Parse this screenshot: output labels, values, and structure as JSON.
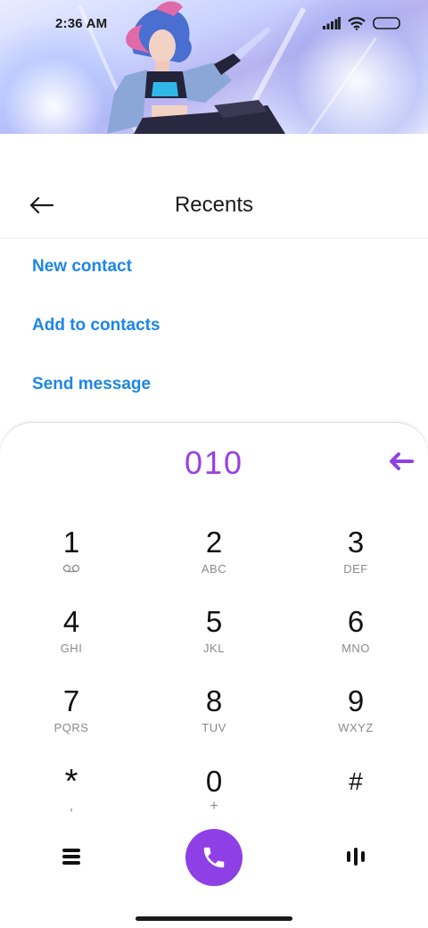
{
  "status_bar": {
    "time": "2:36 AM"
  },
  "header": {
    "title": "Recents"
  },
  "actions": {
    "new_contact": "New contact",
    "add_to_contacts": "Add to contacts",
    "send_message": "Send message"
  },
  "dialer": {
    "number": "010",
    "keys": [
      {
        "digit": "1",
        "letters": ""
      },
      {
        "digit": "2",
        "letters": "ABC"
      },
      {
        "digit": "3",
        "letters": "DEF"
      },
      {
        "digit": "4",
        "letters": "GHI"
      },
      {
        "digit": "5",
        "letters": "JKL"
      },
      {
        "digit": "6",
        "letters": "MNO"
      },
      {
        "digit": "7",
        "letters": "PQRS"
      },
      {
        "digit": "8",
        "letters": "TUV"
      },
      {
        "digit": "9",
        "letters": "WXYZ"
      },
      {
        "digit": "*",
        "letters": ","
      },
      {
        "digit": "0",
        "letters": "+"
      },
      {
        "digit": "#",
        "letters": ""
      }
    ]
  },
  "colors": {
    "accent": "#8e3fe6",
    "link": "#1d86e6",
    "number": "#9b3fe2"
  },
  "icons": {
    "back": "arrow-left-icon",
    "backspace": "backspace-arrow-icon",
    "voicemail": "voicemail-icon",
    "menu": "menu-icon",
    "call": "phone-icon",
    "keypad_toggle": "keypad-bars-icon"
  }
}
